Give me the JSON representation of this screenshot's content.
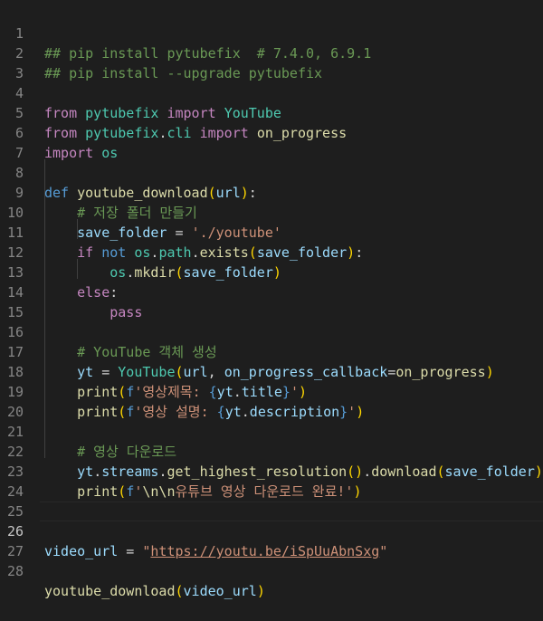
{
  "lines": [
    {
      "no": "1",
      "text": "## pip install pytubefix  # 7.4.0, 6.9.1"
    },
    {
      "no": "2",
      "text": "## pip install --upgrade pytubefix"
    },
    {
      "no": "3",
      "text": ""
    },
    {
      "no": "4",
      "text": "from pytubefix import YouTube"
    },
    {
      "no": "5",
      "text": "from pytubefix.cli import on_progress"
    },
    {
      "no": "6",
      "text": "import os"
    },
    {
      "no": "7",
      "text": ""
    },
    {
      "no": "8",
      "text": "def youtube_download(url):"
    },
    {
      "no": "9",
      "text": "    # 저장 폴더 만들기"
    },
    {
      "no": "10",
      "text": "    save_folder = './youtube'"
    },
    {
      "no": "11",
      "text": "    if not os.path.exists(save_folder):"
    },
    {
      "no": "12",
      "text": "        os.mkdir(save_folder)"
    },
    {
      "no": "13",
      "text": "    else:"
    },
    {
      "no": "14",
      "text": "        pass"
    },
    {
      "no": "15",
      "text": ""
    },
    {
      "no": "16",
      "text": "    # YouTube 객체 생성"
    },
    {
      "no": "17",
      "text": "    yt = YouTube(url, on_progress_callback=on_progress)"
    },
    {
      "no": "18",
      "text": "    print(f'영상제목: {yt.title}')"
    },
    {
      "no": "19",
      "text": "    print(f'영상 설명: {yt.description}')"
    },
    {
      "no": "20",
      "text": ""
    },
    {
      "no": "21",
      "text": "    # 영상 다운로드"
    },
    {
      "no": "22",
      "text": "    yt.streams.get_highest_resolution().download(save_folder)"
    },
    {
      "no": "23",
      "text": "    print(f'\\n\\n유튜브 영상 다운로드 완료!')"
    },
    {
      "no": "24",
      "text": ""
    },
    {
      "no": "25",
      "text": ""
    },
    {
      "no": "26",
      "text": "video_url = \"https://youtu.be/iSpUuAbnSxg\""
    },
    {
      "no": "27",
      "text": ""
    },
    {
      "no": "28",
      "text": "youtube_download(video_url)"
    }
  ],
  "current_line": "26",
  "theme": {
    "background": "#1e1e1e",
    "comment": "#6a9955",
    "keyword": "#569cd6",
    "control": "#c586c0",
    "class": "#4ec9b0",
    "function": "#dcdcaa",
    "variable": "#9cdcfe",
    "string": "#ce9178"
  }
}
